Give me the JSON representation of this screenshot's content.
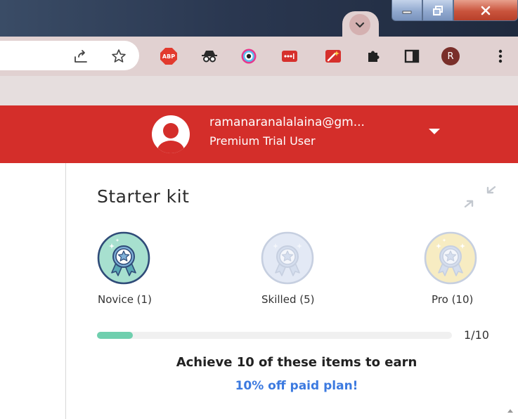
{
  "browser": {
    "profile_initial": "R",
    "extensions": [
      "share-icon",
      "bookmark-star-icon",
      "adblock-plus-icon",
      "incognito-spy-icon",
      "color-picker-icon",
      "password-dots-icon",
      "magic-wand-icon",
      "puzzle-extensions-icon",
      "side-panel-icon"
    ],
    "abp_label": "ABP"
  },
  "user": {
    "email": "ramanaranalalaina@gm...",
    "status": "Premium Trial User"
  },
  "starter_kit": {
    "title": "Starter kit",
    "badges": [
      {
        "label": "Novice (1)",
        "state": "earned",
        "fill": "#a7e0cf",
        "ring": "#2f4b78"
      },
      {
        "label": "Skilled (5)",
        "state": "locked",
        "fill": "#e3e9f5",
        "ring": "#c6cfe0"
      },
      {
        "label": "Pro (10)",
        "state": "locked",
        "fill": "#f7ecc2",
        "ring": "#c6cfe0"
      }
    ],
    "progress": {
      "current": 1,
      "total": 10,
      "fraction": 0.1,
      "label": "1/10"
    },
    "earn_text": "Achieve 10 of these items to earn",
    "reward_text": "10% off paid plan!"
  },
  "colors": {
    "header_red": "#d42e2a",
    "progress_green": "#6fcfae",
    "link_blue": "#3c7ae0"
  }
}
